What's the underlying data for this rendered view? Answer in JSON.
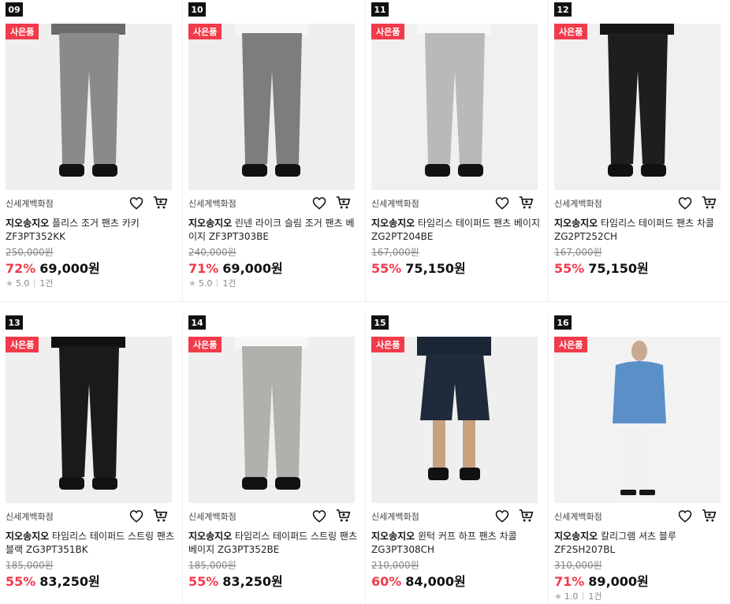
{
  "products": [
    {
      "rank": "09",
      "badge": "사은품",
      "store": "신세계백화점",
      "brand": "지오송지오",
      "name": " 플리스 조거 팬츠 카키 ZF3PT352KK",
      "original_price": "250,000원",
      "discount": "72%",
      "price": "69,000원",
      "rating": "5.0",
      "reviews": "1건",
      "colors": {
        "pant": "#8a8a8a",
        "top": "#6b6b6b",
        "bg": "#efefef"
      }
    },
    {
      "rank": "10",
      "badge": "사은품",
      "store": "신세계백화점",
      "brand": "지오송지오",
      "name": " 린넨 라이크 슬림 조거 팬츠 베이지 ZF3PT303BE",
      "original_price": "240,000원",
      "discount": "71%",
      "price": "69,000원",
      "rating": "5.0",
      "reviews": "1건",
      "colors": {
        "pant": "#7d7d7d",
        "top": "#f5f5f5",
        "bg": "#eeeeee"
      }
    },
    {
      "rank": "11",
      "badge": "사은품",
      "store": "신세계백화점",
      "brand": "지오송지오",
      "name": " 타임리스 테이퍼드 팬츠 베이지 ZG2PT204BE",
      "original_price": "167,000원",
      "discount": "55%",
      "price": "75,150원",
      "rating": "",
      "reviews": "",
      "colors": {
        "pant": "#b9b9b9",
        "top": "#f7f7f7",
        "bg": "#f0f0f0"
      }
    },
    {
      "rank": "12",
      "badge": "사은품",
      "store": "신세계백화점",
      "brand": "지오송지오",
      "name": " 타임리스 테이퍼드 팬츠 차콜 ZG2PT252CH",
      "original_price": "167,000원",
      "discount": "55%",
      "price": "75,150원",
      "rating": "",
      "reviews": "",
      "colors": {
        "pant": "#1e1e1e",
        "top": "#161616",
        "bg": "#f0f0f0"
      }
    },
    {
      "rank": "13",
      "badge": "사은품",
      "store": "신세계백화점",
      "brand": "지오송지오",
      "name": " 타임리스 테이퍼드 스트링 팬츠 블랙 ZG3PT351BK",
      "original_price": "185,000원",
      "discount": "55%",
      "price": "83,250원",
      "rating": "",
      "reviews": "",
      "colors": {
        "pant": "#1a1a1a",
        "top": "#111111",
        "bg": "#efefef"
      }
    },
    {
      "rank": "14",
      "badge": "사은품",
      "store": "신세계백화점",
      "brand": "지오송지오",
      "name": " 타임리스 테이퍼드 스트링 팬츠 베이지 ZG3PT352BE",
      "original_price": "185,000원",
      "discount": "55%",
      "price": "83,250원",
      "rating": "",
      "reviews": "",
      "colors": {
        "pant": "#b2b0ad",
        "top": "#f7f7f7",
        "bg": "#efefef"
      }
    },
    {
      "rank": "15",
      "badge": "사은품",
      "store": "신세계백화점",
      "brand": "지오송지오",
      "name": " 윈턱 커프 하프 팬츠 차콜 ZG3PT308CH",
      "original_price": "210,000원",
      "discount": "60%",
      "price": "84,000원",
      "rating": "",
      "reviews": "",
      "colors": {
        "pant": "#1f2a3a",
        "top": "#1a2535",
        "bg": "#efefef"
      }
    },
    {
      "rank": "16",
      "badge": "사은품",
      "store": "신세계백화점",
      "brand": "지오송지오",
      "name": " 칼리그램 셔츠 블루 ZF2SH207BL",
      "original_price": "310,000원",
      "discount": "71%",
      "price": "89,000원",
      "rating": "1.0",
      "reviews": "1건",
      "colors": {
        "pant": "#f1f1ef",
        "top": "#5a8fc8",
        "bg": "#f2f2f2"
      }
    }
  ],
  "icons": {
    "wishlist": "heart-icon",
    "cart": "cart-icon",
    "star": "star-icon"
  },
  "accent_color": "#f13b4b"
}
